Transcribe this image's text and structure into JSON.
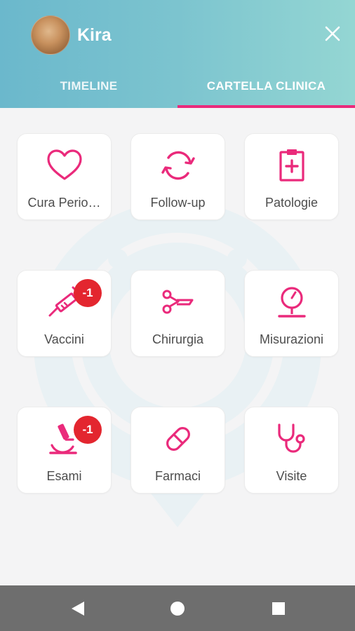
{
  "header": {
    "user_name": "Kira",
    "tabs": [
      {
        "label": "TIMELINE",
        "active": false
      },
      {
        "label": "CARTELLA CLINICA",
        "active": true
      }
    ]
  },
  "colors": {
    "accent": "#ea2a7b",
    "badge": "#e3262f",
    "header_gradient_start": "#6bb8cc",
    "header_gradient_end": "#94d6d3"
  },
  "cards": [
    {
      "label": "Cura Perio…",
      "icon": "heart-icon"
    },
    {
      "label": "Follow-up",
      "icon": "refresh-icon"
    },
    {
      "label": "Patologie",
      "icon": "clipboard-medical-icon"
    },
    {
      "label": "Vaccini",
      "icon": "syringe-icon",
      "badge": "-1"
    },
    {
      "label": "Chirurgia",
      "icon": "scissors-icon"
    },
    {
      "label": "Misurazioni",
      "icon": "gauge-icon"
    },
    {
      "label": "Esami",
      "icon": "microscope-icon",
      "badge": "-1"
    },
    {
      "label": "Farmaci",
      "icon": "pill-icon"
    },
    {
      "label": "Visite",
      "icon": "stethoscope-icon"
    }
  ],
  "navbar": {
    "icons": [
      "back-icon",
      "home-icon",
      "recents-icon"
    ]
  }
}
